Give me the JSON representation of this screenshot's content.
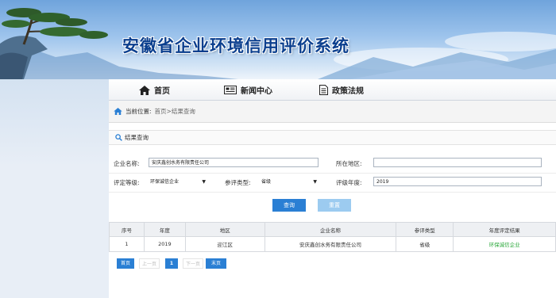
{
  "site": {
    "title": "安徽省企业环境信用评价系统"
  },
  "nav": [
    {
      "label": "首页",
      "icon": "home-icon"
    },
    {
      "label": "新闻中心",
      "icon": "newspaper-icon"
    },
    {
      "label": "政策法规",
      "icon": "document-icon"
    }
  ],
  "breadcrumb": {
    "label": "当前位置:",
    "home": "首页",
    "separator": ">",
    "current": "结果查询"
  },
  "section": {
    "title": "结果查询"
  },
  "form": {
    "company_label": "企业名称:",
    "company_value": "安庆鑫创水务有限责任公司",
    "region_label": "所在地区:",
    "region_value": "",
    "grade_label": "评定等级:",
    "grade_value": "环保诚信企业",
    "type_label": "参评类型:",
    "type_value": "省级",
    "year_label": "评级年度:",
    "year_value": "2019"
  },
  "buttons": {
    "query": "查询",
    "reset": "重置"
  },
  "table": {
    "columns": [
      "序号",
      "年度",
      "地区",
      "企业名称",
      "参评类型",
      "年度评定结果"
    ],
    "rows": [
      {
        "no": "1",
        "year": "2019",
        "region": "迎江区",
        "company": "安庆鑫创水务有限责任公司",
        "type": "省级",
        "result": "环保诚信企业"
      }
    ]
  },
  "pager": {
    "first": "首页",
    "prev": "上一页",
    "page": "1",
    "next": "下一页",
    "last": "末页"
  },
  "colors": {
    "primary": "#2a7fd4",
    "result_green": "#2aa83a",
    "title_blue": "#0b3f8e"
  }
}
